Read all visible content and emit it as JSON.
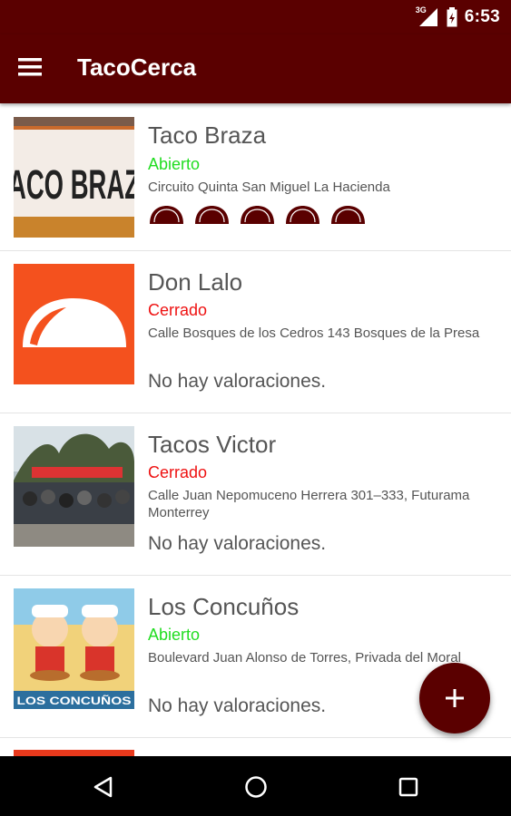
{
  "status_bar": {
    "time": "6:53",
    "network_label": "3G",
    "icons": [
      "signal-icon",
      "battery-icon"
    ]
  },
  "app_bar": {
    "title": "TacoCerca",
    "menu_icon": "menu-icon"
  },
  "colors": {
    "primary": "#5a0000",
    "open": "#22dd22",
    "closed": "#ee1111",
    "text": "#555555"
  },
  "restaurants": [
    {
      "name": "Taco Braza",
      "status": "Abierto",
      "address": "Circuito Quinta San Miguel  La Hacienda",
      "rating": 5,
      "thumb_text": "ACO BRAZ"
    },
    {
      "name": "Don Lalo",
      "status": "Cerrado",
      "address": "Calle Bosques de los Cedros 143 Bosques de la Presa",
      "rating_text": "No hay valoraciones."
    },
    {
      "name": "Tacos Victor",
      "status": "Cerrado",
      "address": "Calle Juan Nepomuceno Herrera 301–333, Futurama Monterrey",
      "rating_text": "No hay valoraciones."
    },
    {
      "name": "Los Concuños",
      "status": "Abierto",
      "address": "Boulevard Juan Alonso de Torres, Privada del Moral",
      "rating_text": "No hay valoraciones.",
      "thumb_text": "LOS CONCUÑOS"
    }
  ],
  "fab": {
    "icon": "add-icon",
    "label": "+"
  },
  "nav_bar": {
    "buttons": [
      "back-icon",
      "home-icon",
      "recents-icon"
    ]
  }
}
